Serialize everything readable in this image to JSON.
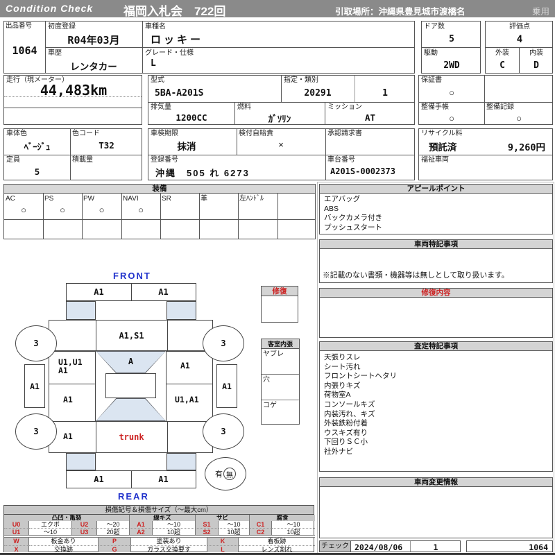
{
  "colors": {
    "header_bg": "#8a8a8a",
    "section_header_bg": "#d4d4d4",
    "legend_header_bg": "#c8c8c8",
    "accent_red": "#cc2222",
    "accent_blue": "#2233cc",
    "diagram_shade": "#dbe5f1"
  },
  "header": {
    "brand": "Condition Check",
    "auction": "福岡入札会　722回",
    "pickup": "引取場所：沖縄県豊見城市渡橋名",
    "category": "乗用"
  },
  "info": {
    "lot_label": "出品番号",
    "lot_value": "1064",
    "first_reg_label": "初度登録",
    "first_reg_value": "R04年03月",
    "model_label": "車種名",
    "model_value": "ロッキー",
    "history_label": "車歴",
    "history_value": "レンタカー",
    "grade_label": "グレード・仕様",
    "grade_value": "L",
    "doors_label": "ドア数",
    "doors_value": "5",
    "drive_label": "駆動",
    "drive_value": "2WD",
    "score_label": "評価点",
    "score_value": "4",
    "exterior_label": "外装",
    "exterior_value": "C",
    "interior_label": "内装",
    "interior_value": "D",
    "mileage_label": "走行（現メーター）",
    "mileage_value": "44,483km",
    "type_label": "型式",
    "type_value": "5BA-A201S",
    "class_label": "指定・類別",
    "class_value1": "20291",
    "class_value2": "1",
    "displacement_label": "排気量",
    "displacement_value": "1200CC",
    "fuel_label": "燃料",
    "fuel_value": "ｶﾞｿﾘﾝ",
    "mission_label": "ミッション",
    "mission_value": "AT",
    "warranty_label": "保証書",
    "warranty_value": "○",
    "book_label": "整備手帳",
    "book_value": "○",
    "record_label": "整備記録",
    "record_value": "○",
    "color_label": "車体色",
    "color_value": "ﾍﾞｰｼﾞｭ",
    "color_code_label": "色コード",
    "color_code_value": "T32",
    "capacity_label": "定員",
    "capacity_value": "5",
    "load_label": "積載量",
    "load_value": "",
    "inspection_label": "車検期限",
    "inspection_value": "抹消",
    "insurance_label": "検付自賠責",
    "insurance_value": "×",
    "approval_label": "承認請求書",
    "approval_value": "",
    "reg_label": "登録番号",
    "reg_value": "沖縄　505 れ 6273",
    "chassis_label": "車台番号",
    "chassis_value": "A201S-0002373",
    "recycle_label": "リサイクル料",
    "recycle_status": "預託済",
    "recycle_fee": "9,260円",
    "welfare_label": "福祉車両",
    "welfare_value": ""
  },
  "equipment": {
    "title": "装備",
    "items": [
      {
        "label": "AC",
        "value": "○"
      },
      {
        "label": "PS",
        "value": "○"
      },
      {
        "label": "PW",
        "value": "○"
      },
      {
        "label": "NAVI",
        "value": "○"
      },
      {
        "label": "SR",
        "value": ""
      },
      {
        "label": "革",
        "value": ""
      },
      {
        "label": "左ﾊﾝﾄﾞﾙ",
        "value": ""
      },
      {
        "label": "",
        "value": ""
      }
    ]
  },
  "appeal": {
    "title": "アピールポイント",
    "items": [
      "エアバッグ",
      "ABS",
      "バックカメラ付き",
      "プッシュスタート"
    ]
  },
  "vehicle_notes": {
    "title": "車両特記事項",
    "note": "※記載のない書類・機器等は無しとして取り扱います。"
  },
  "repair": {
    "title": "修復内容",
    "content": ""
  },
  "assessment": {
    "title": "査定特記事項",
    "items": [
      "天張りスレ",
      "シート汚れ",
      "フロントシートヘタリ",
      "内張りキズ",
      "荷物室A",
      "コンソールキズ",
      "内装汚れ、キズ",
      "外装鉄粉付着",
      "ウスキズ有り",
      "下回りＳＣ小",
      "社外ナビ"
    ]
  },
  "change_info": {
    "title": "車両変更情報",
    "content": ""
  },
  "check": {
    "label": "チェック",
    "date": "2024/08/06",
    "count": "1",
    "lot": "1064"
  },
  "diagram": {
    "front": "FRONT",
    "rear": "REAR",
    "repair_box": "修復",
    "cabin": {
      "title": "客室内張",
      "rows": [
        "ヤブレ",
        "穴",
        "コゲ"
      ]
    },
    "spare_yes": "有",
    "spare_no": "無",
    "marks": {
      "front_bumper_l": "A1",
      "front_bumper_r": "A1",
      "hood": "A1,S1",
      "windshield": "A",
      "front_door_l1": "U1,U1",
      "front_door_l2": "A1",
      "front_door_r": "A1",
      "sill_l": "A1",
      "sill_r": "A1",
      "rear_door_l": "A1",
      "rear_door_r": "U1,A1",
      "quarter_l": "A1",
      "trunk": "trunk",
      "rear_bumper_l": "A1",
      "rear_bumper_r": "A1",
      "wheel_fl": "3",
      "wheel_fr": "3",
      "wheel_rl": "3",
      "wheel_rr": "3"
    }
  },
  "legend": {
    "title": "損傷記号＆損傷サイズ（～最大cm）",
    "groups": [
      "凸凹・亀裂",
      "線キズ",
      "サビ",
      "腐食"
    ],
    "size_rows": [
      [
        "U0",
        "エクボ",
        "U2",
        "～20",
        "A1",
        "～10",
        "S1",
        "～10",
        "C1",
        "～10"
      ],
      [
        "U1",
        "～10",
        "U3",
        "20超",
        "A2",
        "10超",
        "S2",
        "10超",
        "C2",
        "10超"
      ]
    ],
    "mark_rows": [
      [
        "W",
        "板金あり",
        "P",
        "塗装あり",
        "K",
        "看板跡"
      ],
      [
        "X",
        "交換跡",
        "G",
        "ガラス交換要す",
        "L",
        "レンズ割れ"
      ]
    ]
  }
}
